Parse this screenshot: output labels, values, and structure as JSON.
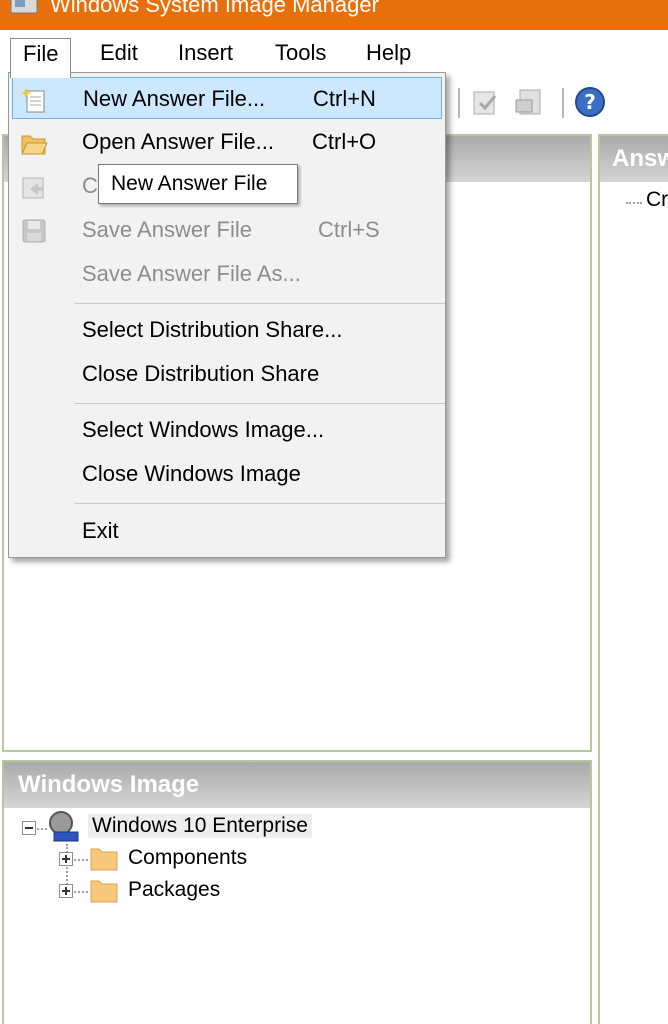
{
  "window": {
    "title": "Windows System Image Manager",
    "accent": "#e8700c"
  },
  "menubar": {
    "items": [
      "File",
      "Edit",
      "Insert",
      "Tools",
      "Help"
    ]
  },
  "file_menu": {
    "items": [
      {
        "label": "New Answer File...",
        "shortcut": "Ctrl+N",
        "icon": "new-file-icon",
        "enabled": true,
        "highlighted": true
      },
      {
        "label": "Open Answer File...",
        "shortcut": "Ctrl+O",
        "icon": "open-folder-icon",
        "enabled": true
      },
      {
        "label": "C",
        "shortcut": "",
        "icon": "close-file-icon",
        "enabled": false
      },
      {
        "label": "Save Answer File",
        "shortcut": "Ctrl+S",
        "icon": "save-disk-icon",
        "enabled": false
      },
      {
        "label": "Save Answer File As...",
        "shortcut": "",
        "enabled": false
      },
      {
        "label": "Select Distribution Share...",
        "enabled": true
      },
      {
        "label": "Close Distribution Share",
        "enabled": true
      },
      {
        "label": "Select Windows Image...",
        "enabled": true
      },
      {
        "label": "Close Windows Image",
        "enabled": true
      },
      {
        "label": "Exit",
        "enabled": true
      }
    ]
  },
  "tooltip": {
    "text": "New Answer File"
  },
  "answer_pane": {
    "title": "Answ",
    "tree_item": "Cr"
  },
  "windows_image_pane": {
    "title": "Windows Image",
    "root": "Windows 10 Enterprise",
    "children": [
      "Components",
      "Packages"
    ]
  },
  "toolbar": {
    "icons": [
      "validate-icon",
      "create-config-icon",
      "help-icon"
    ]
  }
}
